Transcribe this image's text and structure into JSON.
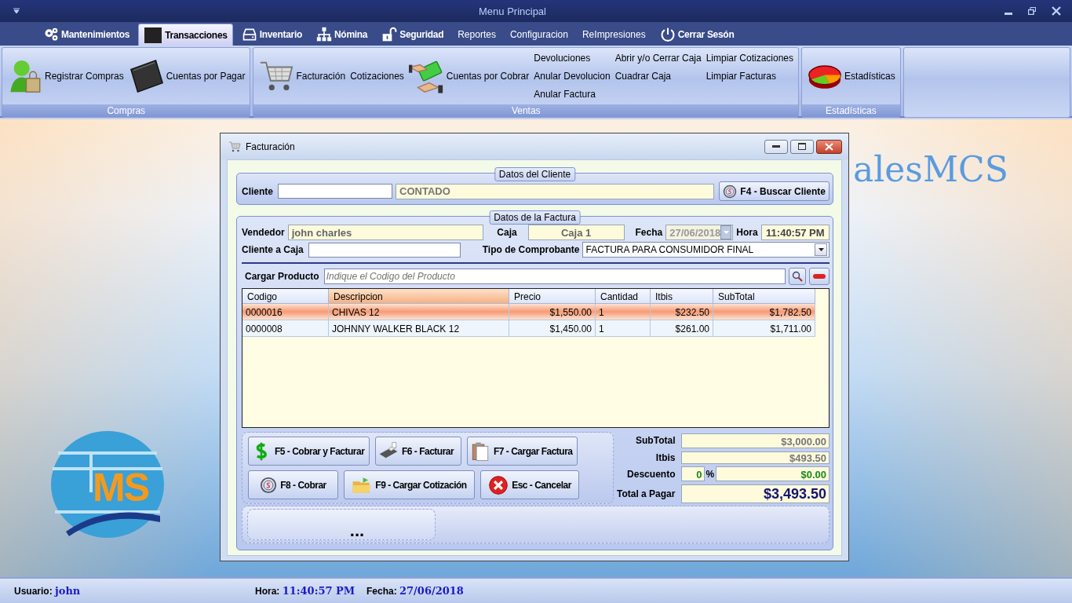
{
  "window": {
    "title": "Menu Principal"
  },
  "menu": [
    {
      "label": "Mantenimientos",
      "selected": false
    },
    {
      "label": "Transacciones",
      "selected": true
    },
    {
      "label": "Inventario",
      "selected": false
    },
    {
      "label": "Nómina",
      "selected": false
    },
    {
      "label": "Seguridad",
      "selected": false
    },
    {
      "label": "Reportes",
      "selected": false
    },
    {
      "label": "Configuracion",
      "selected": false
    },
    {
      "label": "ReImpresiones",
      "selected": false
    },
    {
      "label": "Cerrar Sesón",
      "selected": false
    }
  ],
  "ribbon": {
    "groups": [
      {
        "title": "Compras",
        "items": [
          {
            "kind": "large",
            "label": "Registrar Compras"
          },
          {
            "kind": "large",
            "label": "Cuentas por Pagar"
          }
        ]
      },
      {
        "title": "Ventas",
        "items": [
          {
            "kind": "large",
            "label": "Facturación"
          },
          {
            "kind": "large",
            "label": "Cotizaciones"
          },
          {
            "kind": "large",
            "label": "Cuentas por Cobrar"
          },
          {
            "kind": "column",
            "labels": [
              "Devoluciones",
              "Anular Devolucion",
              "Anular Factura"
            ]
          },
          {
            "kind": "column",
            "labels": [
              "Abrir y/o  Cerrar Caja",
              "Cuadrar Caja"
            ]
          },
          {
            "kind": "column",
            "labels": [
              "Limpiar Cotizaciones",
              "Limpiar Facturas"
            ]
          }
        ]
      },
      {
        "title": "Estadísticas",
        "items": [
          {
            "kind": "large",
            "label": "Estadísticas"
          }
        ]
      }
    ]
  },
  "desktop": {
    "background_text": "alesMCS",
    "logo_text": "MS"
  },
  "dialog": {
    "title": "Facturación",
    "cliente": {
      "legend": "Datos del Cliente",
      "label": "Cliente",
      "name": "CONTADO",
      "search_button": "F4 - Buscar Cliente"
    },
    "factura": {
      "legend": "Datos de la Factura",
      "vendedor_label": "Vendedor",
      "vendedor": "john charles",
      "caja_label": "Caja",
      "caja": "Caja 1",
      "fecha_label": "Fecha",
      "fecha": {
        "value": "27/06/2018",
        "disabled": true
      },
      "hora_label": "Hora",
      "hora": "11:40:57 PM",
      "cliente_caja_label": "Cliente a Caja",
      "comprobante_label": "Tipo de Comprobante",
      "comprobante": "FACTURA PARA CONSUMIDOR FINAL",
      "producto_label": "Cargar Producto",
      "producto_placeholder": "Indique el Codigo del Producto"
    },
    "table": {
      "columns": [
        {
          "label": "Codigo",
          "kind": "text",
          "selected": false
        },
        {
          "label": "Descripcion",
          "kind": "text",
          "selected": true
        },
        {
          "label": "Precio",
          "kind": "money",
          "selected": false
        },
        {
          "label": "Cantidad",
          "kind": "text",
          "selected": false
        },
        {
          "label": "Itbis",
          "kind": "money",
          "selected": false
        },
        {
          "label": "SubTotal",
          "kind": "money",
          "selected": false
        }
      ],
      "rows": [
        {
          "cells": [
            "0000016",
            "CHIVAS 12",
            "$1,550.00",
            "1",
            "$232.50",
            "$1,782.50"
          ],
          "selected": true
        },
        {
          "cells": [
            "0000008",
            "JOHNNY WALKER BLACK 12",
            "$1,450.00",
            "1",
            "$261.00",
            "$1,711.00"
          ],
          "selected": false
        }
      ]
    },
    "actions": [
      {
        "label": "F5 - Cobrar y Facturar"
      },
      {
        "label": "F6 - Facturar"
      },
      {
        "label": "F7 - Cargar Factura"
      },
      {
        "label": "F8 - Cobrar"
      },
      {
        "label": "F9 - Cargar Cotización"
      },
      {
        "label": "Esc - Cancelar"
      }
    ],
    "totals": {
      "subtotal_label": "SubTotal",
      "subtotal": "$3,000.00",
      "itbis_label": "Itbis",
      "itbis": "$493.50",
      "descuento_label": "Descuento",
      "descuento_pct": "0",
      "pct_sign": "%",
      "descuento": "$0.00",
      "total_label": "Total a Pagar",
      "total": "$3,493.50"
    },
    "message": "..."
  },
  "status_bar": {
    "usuario_label": "Usuario:",
    "usuario": "john",
    "hora_label": "Hora:",
    "hora": "11:40:57 PM",
    "fecha_label": "Fecha:",
    "fecha": "27/06/2018"
  }
}
